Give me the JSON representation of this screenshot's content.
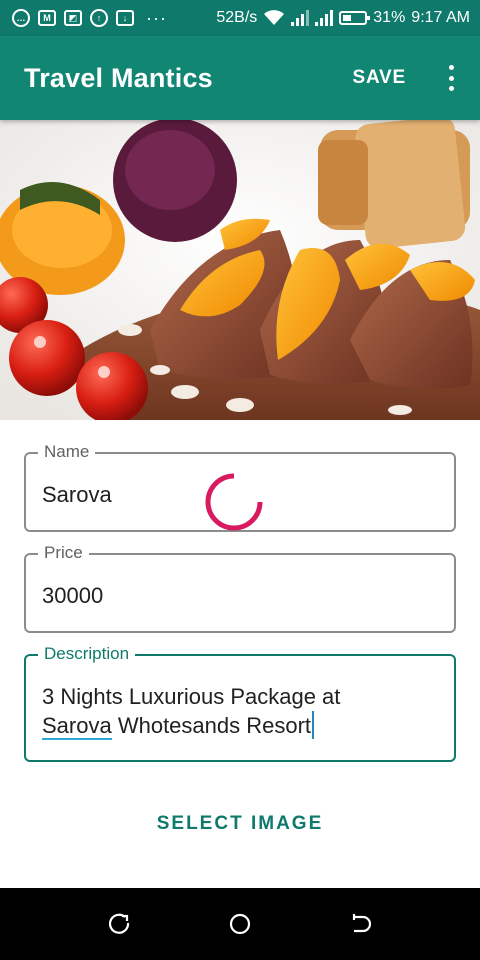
{
  "status_bar": {
    "network_speed": "52B/s",
    "battery": "31%",
    "time": "9:17 AM",
    "dots": "···",
    "icons": [
      "messenger-icon",
      "mail-icon",
      "gallery-icon",
      "cloud-upload-icon",
      "download-icon",
      "wifi-icon",
      "signal-icon",
      "signal-icon",
      "battery-icon"
    ]
  },
  "app_bar": {
    "title": "Travel Mantics",
    "save_label": "SAVE",
    "overflow_icon": "more-vert-icon"
  },
  "hero_image": {
    "description_icon": "food-photo"
  },
  "form": {
    "name": {
      "label": "Name",
      "value": "Sarova"
    },
    "price": {
      "label": "Price",
      "value": "30000"
    },
    "description": {
      "label": "Description",
      "line1": "3 Nights Luxurious Package at",
      "line2_underlined": "Sarova",
      "line2_rest": " Whotesands Resort"
    }
  },
  "select_image_label": "SELECT IMAGE",
  "colors": {
    "primary": "#118673",
    "primary_dark": "#0f7a6b",
    "accent": "#d81b60",
    "spinner": "#d81b60"
  },
  "nav_bar": {
    "icons": [
      "recent-apps-icon",
      "home-icon",
      "back-icon"
    ]
  }
}
